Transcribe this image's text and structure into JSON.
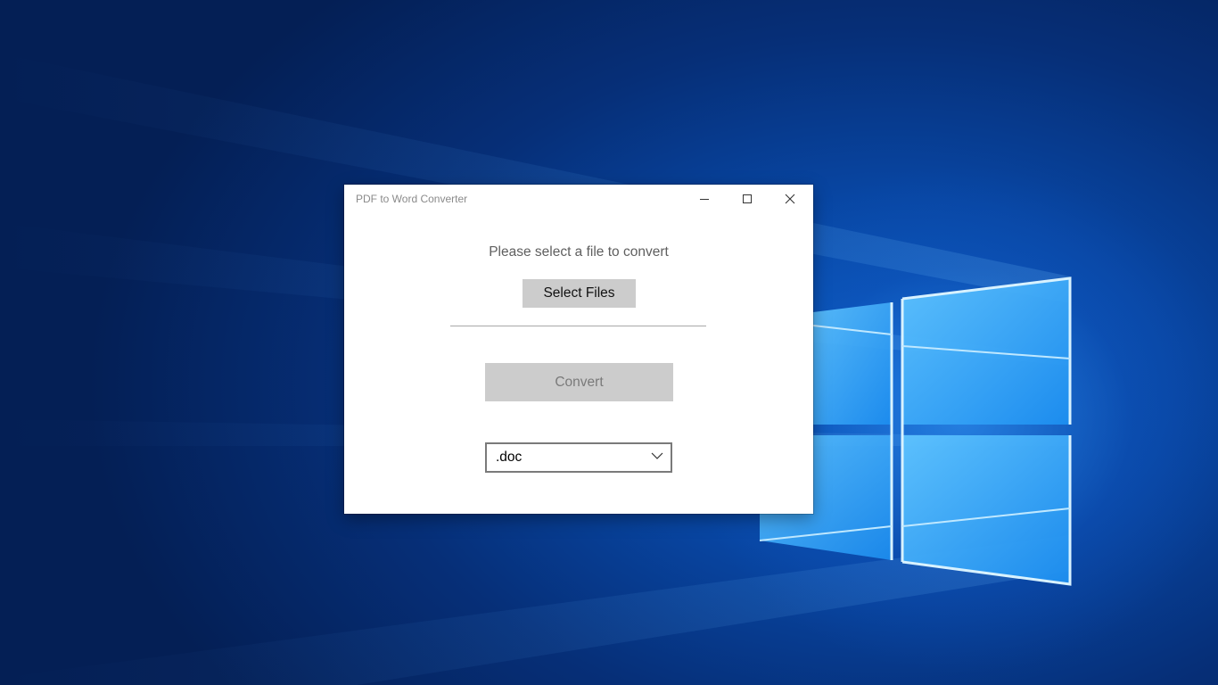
{
  "window": {
    "title": "PDF to Word Converter",
    "controls": {
      "minimize_icon": "minimize-icon",
      "maximize_icon": "maximize-icon",
      "close_icon": "close-icon"
    }
  },
  "main": {
    "prompt": "Please select a file to convert",
    "select_files_label": "Select Files",
    "convert_label": "Convert",
    "convert_enabled": false,
    "format_select": {
      "selected": ".doc",
      "icon": "chevron-down-icon"
    }
  },
  "desktop": {
    "wallpaper": "windows-10-hero",
    "colors": {
      "wallpaper_blue": "#0846a3",
      "window_background": "#ffffff",
      "button_gray": "#cccccc"
    }
  }
}
